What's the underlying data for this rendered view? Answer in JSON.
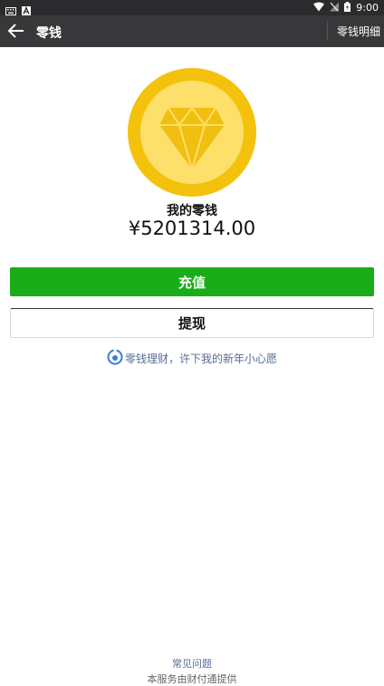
{
  "status_bar": {
    "time": "9:00",
    "icons": [
      "keyboard-icon",
      "font-icon",
      "wifi-icon",
      "signal-off-icon",
      "battery-icon"
    ]
  },
  "app_bar": {
    "title": "零钱",
    "detail_label": "零钱明细"
  },
  "balance": {
    "label": "我的零钱",
    "amount": "¥5201314.00"
  },
  "actions": {
    "recharge_label": "充值",
    "withdraw_label": "提现"
  },
  "promo": {
    "text": "零钱理财，许下我的新年小心愿"
  },
  "footer": {
    "faq_label": "常见问题",
    "provider_text": "本服务由财付通提供"
  },
  "colors": {
    "primary_green": "#1aad19",
    "link_blue": "#576b95",
    "app_bar": "#38383a",
    "coin_outer": "#f4c20d",
    "coin_inner": "#fde06a"
  }
}
